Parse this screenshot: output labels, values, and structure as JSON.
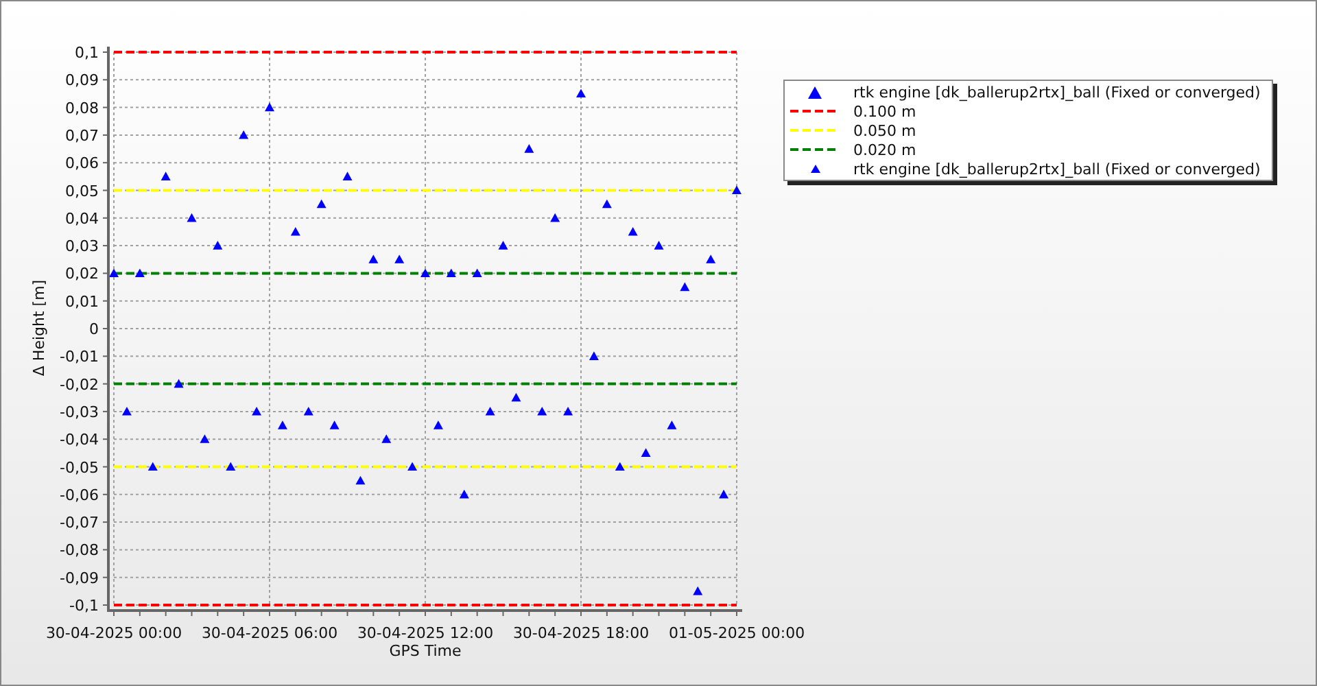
{
  "chart": {
    "chart_data": {
      "type": "scatter",
      "xlabel": "GPS Time",
      "ylabel": "Δ Height [m]",
      "ylim": [
        -0.1,
        0.1
      ],
      "yticks": [
        {
          "value": 0.1,
          "label": "0,1"
        },
        {
          "value": 0.09,
          "label": "0,09"
        },
        {
          "value": 0.08,
          "label": "0,08"
        },
        {
          "value": 0.07,
          "label": "0,07"
        },
        {
          "value": 0.06,
          "label": "0,06"
        },
        {
          "value": 0.05,
          "label": "0,05"
        },
        {
          "value": 0.04,
          "label": "0,04"
        },
        {
          "value": 0.03,
          "label": "0,03"
        },
        {
          "value": 0.02,
          "label": "0,02"
        },
        {
          "value": 0.01,
          "label": "0,01"
        },
        {
          "value": 0,
          "label": "0"
        },
        {
          "value": -0.01,
          "label": "-0,01"
        },
        {
          "value": -0.02,
          "label": "-0,02"
        },
        {
          "value": -0.03,
          "label": "-0,03"
        },
        {
          "value": -0.04,
          "label": "-0,04"
        },
        {
          "value": -0.05,
          "label": "-0,05"
        },
        {
          "value": -0.06,
          "label": "-0,06"
        },
        {
          "value": -0.07,
          "label": "-0,07"
        },
        {
          "value": -0.08,
          "label": "-0,08"
        },
        {
          "value": -0.09,
          "label": "-0,09"
        },
        {
          "value": -0.1,
          "label": "-0,1"
        }
      ],
      "categories": [
        "30-04-2025 00:00",
        null,
        null,
        null,
        null,
        null,
        null,
        null,
        null,
        null,
        null,
        null,
        "30-04-2025 06:00",
        null,
        null,
        null,
        null,
        null,
        null,
        null,
        null,
        null,
        null,
        null,
        "30-04-2025 12:00",
        null,
        null,
        null,
        null,
        null,
        null,
        null,
        null,
        null,
        null,
        null,
        "30-04-2025 18:00",
        null,
        null,
        null,
        null,
        null,
        null,
        null,
        null,
        null,
        null,
        null,
        "01-05-2025 00:00"
      ],
      "series": [
        {
          "name": "rtk engine [dk_ballerup2rtx]_ball (Fixed or converged)",
          "color": "#0000ff",
          "values": [
            0.02,
            -0.03,
            0.02,
            -0.05,
            0.055,
            -0.02,
            0.04,
            -0.04,
            0.03,
            -0.05,
            0.07,
            -0.03,
            0.08,
            -0.035,
            0.035,
            -0.03,
            0.045,
            -0.035,
            0.055,
            -0.055,
            0.025,
            -0.04,
            0.025,
            -0.05,
            0.02,
            -0.035,
            0.02,
            -0.06,
            0.02,
            -0.03,
            0.03,
            -0.025,
            0.065,
            -0.03,
            0.04,
            -0.03,
            0.085,
            -0.01,
            0.045,
            -0.05,
            0.035,
            -0.045,
            0.03,
            -0.035,
            0.015,
            -0.095,
            0.025,
            -0.06,
            0.05
          ]
        }
      ],
      "grid": true
    },
    "thresholds": [
      {
        "label": "0.100 m",
        "color": "#ff0000"
      },
      {
        "label": "0.050 m",
        "color": "#ffff00"
      },
      {
        "label": "0.020 m",
        "color": "#008000"
      }
    ]
  },
  "legend": {
    "extra_items": [
      {
        "label": "rtk engine [dk_ballerup2rtx]_ball (Fixed or converged)",
        "color": "#0000ff"
      }
    ]
  }
}
